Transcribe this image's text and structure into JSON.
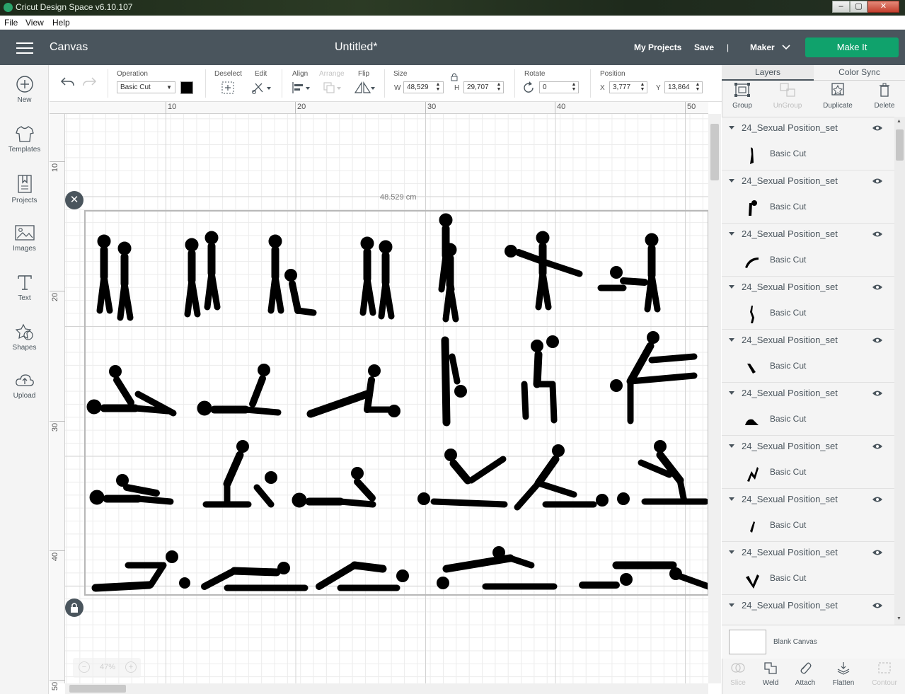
{
  "window": {
    "title": "Cricut Design Space  v6.10.107"
  },
  "menu": [
    "File",
    "View",
    "Help"
  ],
  "header": {
    "section": "Canvas",
    "doc_title": "Untitled*",
    "my_projects": "My Projects",
    "save": "Save",
    "divider": "|",
    "machine": "Maker",
    "make_it": "Make It"
  },
  "sidebar": [
    {
      "label": "New",
      "icon": "plus-circle-icon"
    },
    {
      "label": "Templates",
      "icon": "tshirt-icon"
    },
    {
      "label": "Projects",
      "icon": "bookmark-icon"
    },
    {
      "label": "Images",
      "icon": "image-icon"
    },
    {
      "label": "Text",
      "icon": "text-t-icon"
    },
    {
      "label": "Shapes",
      "icon": "shapes-icon"
    },
    {
      "label": "Upload",
      "icon": "cloud-upload-icon"
    }
  ],
  "toolbar": {
    "operation_label": "Operation",
    "operation_value": "Basic Cut",
    "deselect_label": "Deselect",
    "edit_label": "Edit",
    "align_label": "Align",
    "arrange_label": "Arrange",
    "flip_label": "Flip",
    "size_label": "Size",
    "w_label": "W",
    "w_value": "48,529",
    "h_label": "H",
    "h_value": "29,707",
    "rotate_label": "Rotate",
    "rotate_value": "0",
    "position_label": "Position",
    "x_label": "X",
    "x_value": "3,777",
    "y_label": "Y",
    "y_value": "13,864"
  },
  "ruler": {
    "top": [
      "10",
      "20",
      "30",
      "40",
      "50"
    ],
    "left": [
      "10",
      "20",
      "30",
      "40",
      "50"
    ]
  },
  "canvas": {
    "selection_width": "48.529 cm",
    "zoom_level": "47%",
    "zoom_minus": "−",
    "zoom_plus": "+"
  },
  "panel": {
    "tabs": [
      "Layers",
      "Color Sync"
    ],
    "tools": [
      {
        "label": "Group",
        "enabled": true
      },
      {
        "label": "UnGroup",
        "enabled": false
      },
      {
        "label": "Duplicate",
        "enabled": true
      },
      {
        "label": "Delete",
        "enabled": true
      }
    ],
    "layers": [
      {
        "name": "24_Sexual Position_set",
        "op": "Basic Cut"
      },
      {
        "name": "24_Sexual Position_set",
        "op": "Basic Cut"
      },
      {
        "name": "24_Sexual Position_set",
        "op": "Basic Cut"
      },
      {
        "name": "24_Sexual Position_set",
        "op": "Basic Cut"
      },
      {
        "name": "24_Sexual Position_set",
        "op": "Basic Cut"
      },
      {
        "name": "24_Sexual Position_set",
        "op": "Basic Cut"
      },
      {
        "name": "24_Sexual Position_set",
        "op": "Basic Cut"
      },
      {
        "name": "24_Sexual Position_set",
        "op": "Basic Cut"
      },
      {
        "name": "24_Sexual Position_set",
        "op": "Basic Cut"
      },
      {
        "name": "24_Sexual Position_set",
        "op": ""
      }
    ],
    "blank_canvas": "Blank Canvas",
    "bottom_tools": [
      {
        "label": "Slice",
        "enabled": false
      },
      {
        "label": "Weld",
        "enabled": true
      },
      {
        "label": "Attach",
        "enabled": true
      },
      {
        "label": "Flatten",
        "enabled": true
      },
      {
        "label": "Contour",
        "enabled": false
      }
    ]
  },
  "colors": {
    "header_bg": "#4a555d",
    "make_it_green": "#10a26c",
    "figure_black": "#000000"
  }
}
